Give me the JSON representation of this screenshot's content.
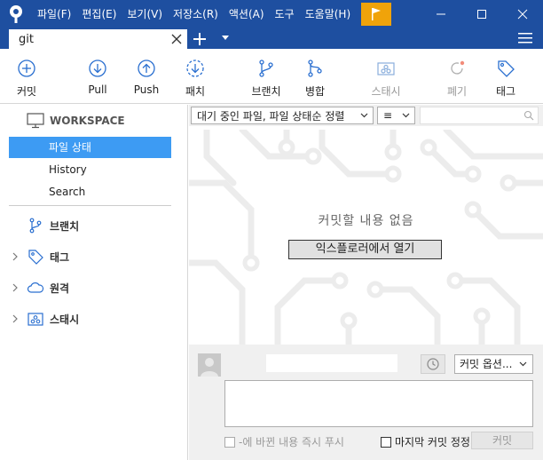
{
  "menu": [
    "파일(F)",
    "편집(E)",
    "보기(V)",
    "저장소(R)",
    "액션(A)",
    "도구",
    "도움말(H)"
  ],
  "tab": {
    "title": "git"
  },
  "toolbar": {
    "commit": "커밋",
    "pull": "Pull",
    "push": "Push",
    "fetch": "패치",
    "branch": "브랜치",
    "merge": "병합",
    "stash": "스태시",
    "discard": "폐기",
    "tag": "태그"
  },
  "sidebar": {
    "workspace": "WORKSPACE",
    "items": [
      "파일 상태",
      "History",
      "Search"
    ],
    "groups": {
      "branches": "브랜치",
      "tags": "태그",
      "remotes": "원격",
      "stashes": "스태시"
    }
  },
  "filter": {
    "status_select": "대기 중인 파일, 파일 상태순 정렬",
    "view_select": "≡"
  },
  "main": {
    "empty_message": "커밋할 내용 없음",
    "open_explorer": "익스플로러에서 열기"
  },
  "commit": {
    "options": "커밋 옵션...",
    "push_immediately": "-에 바뀐 내용 즉시 푸시",
    "amend_last": "마지막 커밋 정정",
    "commit_button": "커밋"
  },
  "colors": {
    "titlebar": "#1E4FA0",
    "accent": "#3D9BF3",
    "flag": "#F0A30A",
    "icon_blue": "#2A6FD0"
  }
}
